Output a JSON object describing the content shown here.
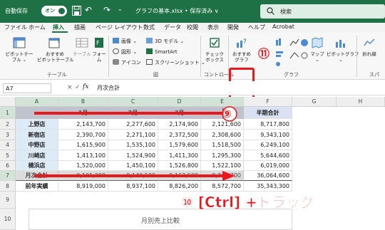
{
  "titlebar": {
    "autosave_label": "自動保存",
    "autosave_state": "オン",
    "filename": "グラフの基本.xlsx • 保存済み ∨",
    "search_label": "検索"
  },
  "menu": {
    "tabs": [
      "ファイル",
      "ホーム",
      "挿入",
      "描画",
      "ページ レイアウト",
      "数式",
      "データ",
      "校閲",
      "表示",
      "開発",
      "ヘルプ",
      "Acrobat"
    ],
    "active": "挿入"
  },
  "ribbon": {
    "pivot_table": "ピボットテー\nブル ⌄",
    "recommended_pivot": "おすすめ\nピボットテーブル",
    "table": "テーブル",
    "form": "フォー\nム",
    "group_table": "テーブル",
    "image": "画像 ⌄",
    "shape": "図形 ⌄",
    "icon": "アイコン",
    "model3d": "3D モデル ⌄",
    "smartart": "SmartArt",
    "screenshot": "スクリーンショット ⌄",
    "group_figure": "図",
    "checkbox": "チェック\nボックス",
    "group_control": "コントロール",
    "recommended_chart": "おすすめ\nグラフ",
    "map": "マップ\n⌄",
    "pivot_chart": "ピボットグラフ\n⌄",
    "group_chart": "グラフ",
    "line_chart": "折れ線",
    "group_sparkline": "スパ",
    "step_11": "⑪"
  },
  "formula": {
    "name_box": "A7",
    "content": "月次合計"
  },
  "sheet": {
    "columns": [
      "A",
      "B",
      "C",
      "D",
      "E",
      "F",
      "G",
      "H"
    ],
    "rows": [
      "1",
      "2",
      "3",
      "4",
      "5",
      "6",
      "7",
      "8",
      "9",
      "10"
    ],
    "header_row": [
      "",
      "1月",
      "2月",
      "3月",
      "",
      "半期合計"
    ],
    "data": [
      {
        "store": "上野店",
        "b": "2,143,700",
        "c": "2,277,600",
        "d": "2,174,900",
        "e": "2,121,600",
        "f": "8,717,800"
      },
      {
        "store": "新宿店",
        "b": "2,390,700",
        "c": "2,271,100",
        "d": "2,372,500",
        "e": "2,308,600",
        "f": "9,343,100"
      },
      {
        "store": "中野店",
        "b": "1,615,900",
        "c": "1,535,100",
        "d": "1,579,600",
        "e": "1,518,500",
        "f": "6,249,100"
      },
      {
        "store": "川崎店",
        "b": "1,413,100",
        "c": "1,524,900",
        "d": "1,411,300",
        "e": "1,295,300",
        "f": "5,644,600"
      },
      {
        "store": "横浜店",
        "b": "1,520,000",
        "c": "1,450,100",
        "d": "1,526,800",
        "e": "1,522,100",
        "f": "6,019,000"
      }
    ],
    "total": {
      "label": "月次合計",
      "b": "9,101,200",
      "c": "9,140,500",
      "d": "9,163,500",
      "e": "8,747,700",
      "f": "36,064,600"
    },
    "prev": {
      "label": "前年実績",
      "b": "8,919,000",
      "c": "8,937,100",
      "d": "8,826,200",
      "e": "8,572,700",
      "f": "35,343,300"
    }
  },
  "chart": {
    "title": "月別売上比較"
  },
  "annotations": {
    "step_9": "⑨",
    "step_10_label": "⑩ [Ctrl] +ドラッグ"
  },
  "colors": {
    "excel_green": "#1e7145",
    "highlight_red": "#e8181c"
  }
}
